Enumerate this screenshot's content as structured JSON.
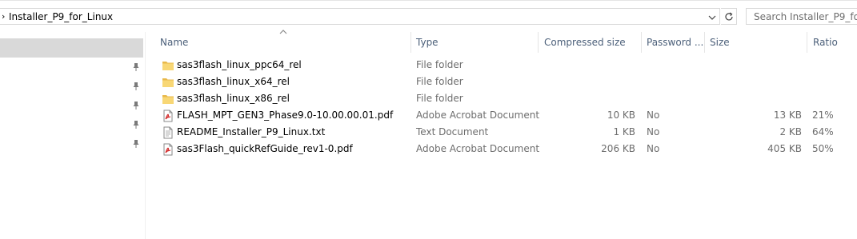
{
  "address": {
    "path": "Installer_P9_for_Linux"
  },
  "search": {
    "placeholder": "Search Installer_P9_for_Linux"
  },
  "columns": {
    "name": "Name",
    "type": "Type",
    "compressed_size": "Compressed size",
    "password": "Password ...",
    "size": "Size",
    "ratio": "Ratio"
  },
  "files": [
    {
      "icon": "folder-icon",
      "name": "sas3flash_linux_ppc64_rel",
      "type": "File folder",
      "compressed": "",
      "password": "",
      "size": "",
      "ratio": ""
    },
    {
      "icon": "folder-icon",
      "name": "sas3flash_linux_x64_rel",
      "type": "File folder",
      "compressed": "",
      "password": "",
      "size": "",
      "ratio": ""
    },
    {
      "icon": "folder-icon",
      "name": "sas3flash_linux_x86_rel",
      "type": "File folder",
      "compressed": "",
      "password": "",
      "size": "",
      "ratio": ""
    },
    {
      "icon": "pdf-icon",
      "name": "FLASH_MPT_GEN3_Phase9.0-10.00.00.01.pdf",
      "type": "Adobe Acrobat Document",
      "compressed": "10 KB",
      "password": "No",
      "size": "13 KB",
      "ratio": "21%"
    },
    {
      "icon": "text-file-icon",
      "name": "README_Installer_P9_Linux.txt",
      "type": "Text Document",
      "compressed": "1 KB",
      "password": "No",
      "size": "2 KB",
      "ratio": "64%"
    },
    {
      "icon": "pdf-icon",
      "name": "sas3Flash_quickRefGuide_rev1-0.pdf",
      "type": "Adobe Acrobat Document",
      "compressed": "206 KB",
      "password": "No",
      "size": "405 KB",
      "ratio": "50%"
    }
  ],
  "colors": {
    "header_text": "#4c607a",
    "folder": "#f8d775",
    "pdf_red": "#d32f2f",
    "nav_selected": "#d9d9d9"
  }
}
